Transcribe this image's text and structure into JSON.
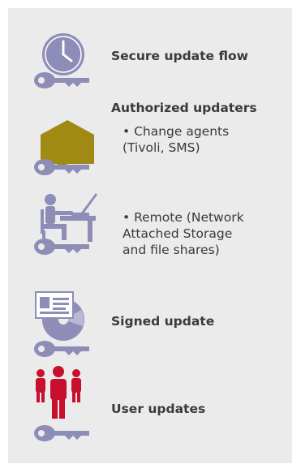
{
  "items": [
    {
      "label": "Secure update flow"
    },
    {
      "label": "Authorized updaters"
    },
    {
      "label": "Signed update"
    },
    {
      "label": "User updates"
    }
  ],
  "bullets": [
    {
      "lines": [
        "• Change agents",
        "(Tivoli, SMS)"
      ]
    },
    {
      "lines": [
        "• Remote (Network",
        "Attached Storage",
        "and file shares)"
      ]
    }
  ],
  "colors": {
    "background": "#ebebeb",
    "icon_purple": "#8d8db7",
    "package_olive": "#a08a14",
    "people_red": "#c8102e",
    "text": "#3a3a3a"
  },
  "icons": [
    "clock-key-icon",
    "package-key-icon",
    "person-at-desk-key-icon",
    "certificate-disc-key-icon",
    "people-key-icon"
  ]
}
